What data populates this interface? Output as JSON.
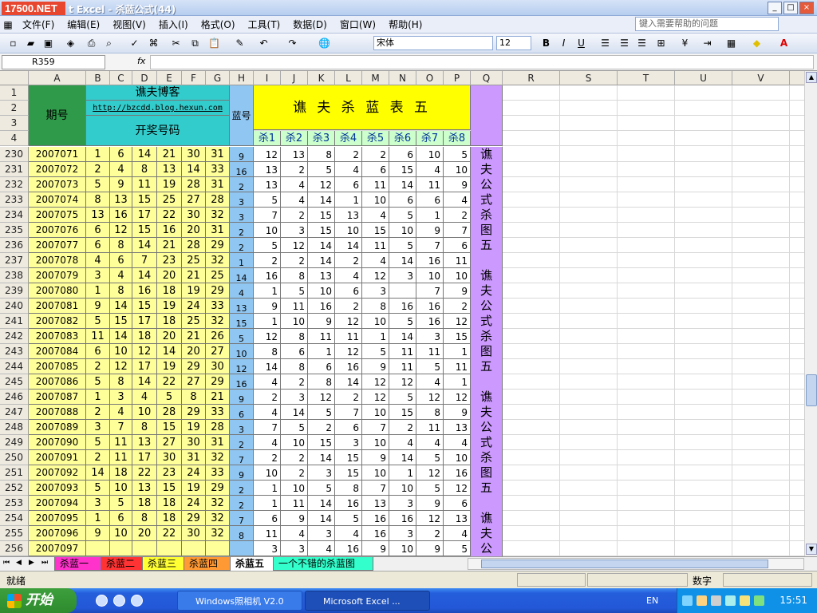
{
  "titlebar": {
    "logo": "17500.NET",
    "title": "t Excel - 杀蓝公式(44)",
    "min": "_",
    "max": "□",
    "close": "×"
  },
  "menu": [
    "文件(F)",
    "编辑(E)",
    "视图(V)",
    "插入(I)",
    "格式(O)",
    "工具(T)",
    "数据(D)",
    "窗口(W)",
    "帮助(H)"
  ],
  "help_placeholder": "键入需要帮助的问题",
  "font": {
    "name": "宋体",
    "size": "12"
  },
  "formula": {
    "cell": "R359",
    "fx": "fx",
    "value": ""
  },
  "columns": [
    "A",
    "B",
    "C",
    "D",
    "E",
    "F",
    "G",
    "H",
    "I",
    "J",
    "K",
    "L",
    "M",
    "N",
    "O",
    "P",
    "Q",
    "R",
    "S",
    "T",
    "U",
    "V"
  ],
  "header": {
    "rows": [
      "1",
      "2",
      "3",
      "4"
    ],
    "period": "期号",
    "blog": "谯夫博客",
    "url": "http://bzcdd.blog.hexun.com",
    "draw": "开奖号码",
    "blue": "蓝号",
    "table_title": "谯 夫 杀 蓝 表 五",
    "kill_cols": [
      "杀1",
      "杀2",
      "杀3",
      "杀4",
      "杀5",
      "杀6",
      "杀7",
      "杀8"
    ]
  },
  "rows": [
    {
      "r": "230",
      "p": "2007071",
      "n": [
        "1",
        "6",
        "14",
        "21",
        "30",
        "31"
      ],
      "b": "9",
      "k": [
        "12",
        "13",
        "8",
        "2",
        "2",
        "6",
        "10",
        "5"
      ],
      "q": "谯"
    },
    {
      "r": "231",
      "p": "2007072",
      "n": [
        "2",
        "4",
        "8",
        "13",
        "14",
        "33"
      ],
      "b": "16",
      "k": [
        "13",
        "2",
        "5",
        "4",
        "6",
        "15",
        "4",
        "10"
      ],
      "q": "夫"
    },
    {
      "r": "232",
      "p": "2007073",
      "n": [
        "5",
        "9",
        "11",
        "19",
        "28",
        "31"
      ],
      "b": "2",
      "k": [
        "13",
        "4",
        "12",
        "6",
        "11",
        "14",
        "11",
        "9"
      ],
      "q": "公"
    },
    {
      "r": "233",
      "p": "2007074",
      "n": [
        "8",
        "13",
        "15",
        "25",
        "27",
        "28"
      ],
      "b": "3",
      "k": [
        "5",
        "4",
        "14",
        "1",
        "10",
        "6",
        "6",
        "4"
      ],
      "q": "式"
    },
    {
      "r": "234",
      "p": "2007075",
      "n": [
        "13",
        "16",
        "17",
        "22",
        "30",
        "32"
      ],
      "b": "3",
      "k": [
        "7",
        "2",
        "15",
        "13",
        "4",
        "5",
        "1",
        "2"
      ],
      "q": "杀"
    },
    {
      "r": "235",
      "p": "2007076",
      "n": [
        "6",
        "12",
        "15",
        "16",
        "20",
        "31"
      ],
      "b": "2",
      "k": [
        "10",
        "3",
        "15",
        "10",
        "15",
        "10",
        "9",
        "7"
      ],
      "q": "图"
    },
    {
      "r": "236",
      "p": "2007077",
      "n": [
        "6",
        "8",
        "14",
        "21",
        "28",
        "29"
      ],
      "b": "2",
      "k": [
        "5",
        "12",
        "14",
        "14",
        "11",
        "5",
        "7",
        "6"
      ],
      "q": "五"
    },
    {
      "r": "237",
      "p": "2007078",
      "n": [
        "4",
        "6",
        "7",
        "23",
        "25",
        "32"
      ],
      "b": "1",
      "k": [
        "2",
        "2",
        "14",
        "2",
        "4",
        "14",
        "16",
        "11"
      ],
      "q": ""
    },
    {
      "r": "238",
      "p": "2007079",
      "n": [
        "3",
        "4",
        "14",
        "20",
        "21",
        "25"
      ],
      "b": "14",
      "k": [
        "16",
        "8",
        "13",
        "4",
        "12",
        "3",
        "10",
        "10"
      ],
      "q": "谯"
    },
    {
      "r": "239",
      "p": "2007080",
      "n": [
        "1",
        "8",
        "16",
        "18",
        "19",
        "29"
      ],
      "b": "4",
      "k": [
        "1",
        "5",
        "10",
        "6",
        "3",
        "",
        "7",
        "9"
      ],
      "q": "夫"
    },
    {
      "r": "240",
      "p": "2007081",
      "n": [
        "9",
        "14",
        "15",
        "19",
        "24",
        "33"
      ],
      "b": "13",
      "k": [
        "9",
        "11",
        "16",
        "2",
        "8",
        "16",
        "16",
        "2"
      ],
      "q": "公"
    },
    {
      "r": "241",
      "p": "2007082",
      "n": [
        "5",
        "15",
        "17",
        "18",
        "25",
        "32"
      ],
      "b": "15",
      "k": [
        "1",
        "10",
        "9",
        "12",
        "10",
        "5",
        "16",
        "12"
      ],
      "q": "式"
    },
    {
      "r": "242",
      "p": "2007083",
      "n": [
        "11",
        "14",
        "18",
        "20",
        "21",
        "26"
      ],
      "b": "5",
      "k": [
        "12",
        "8",
        "11",
        "11",
        "1",
        "14",
        "3",
        "15"
      ],
      "q": "杀"
    },
    {
      "r": "243",
      "p": "2007084",
      "n": [
        "6",
        "10",
        "12",
        "14",
        "20",
        "27"
      ],
      "b": "10",
      "k": [
        "8",
        "6",
        "1",
        "12",
        "5",
        "11",
        "11",
        "1"
      ],
      "q": "图"
    },
    {
      "r": "244",
      "p": "2007085",
      "n": [
        "2",
        "12",
        "17",
        "19",
        "29",
        "30"
      ],
      "b": "12",
      "k": [
        "14",
        "8",
        "6",
        "16",
        "9",
        "11",
        "5",
        "11"
      ],
      "q": "五"
    },
    {
      "r": "245",
      "p": "2007086",
      "n": [
        "5",
        "8",
        "14",
        "22",
        "27",
        "29"
      ],
      "b": "16",
      "k": [
        "4",
        "2",
        "8",
        "14",
        "12",
        "12",
        "4",
        "1"
      ],
      "q": ""
    },
    {
      "r": "246",
      "p": "2007087",
      "n": [
        "1",
        "3",
        "4",
        "5",
        "8",
        "21"
      ],
      "b": "9",
      "k": [
        "2",
        "3",
        "12",
        "2",
        "12",
        "5",
        "12",
        "12"
      ],
      "q": "谯"
    },
    {
      "r": "247",
      "p": "2007088",
      "n": [
        "2",
        "4",
        "10",
        "28",
        "29",
        "33"
      ],
      "b": "6",
      "k": [
        "4",
        "14",
        "5",
        "7",
        "10",
        "15",
        "8",
        "9"
      ],
      "q": "夫"
    },
    {
      "r": "248",
      "p": "2007089",
      "n": [
        "3",
        "7",
        "8",
        "15",
        "19",
        "28"
      ],
      "b": "3",
      "k": [
        "7",
        "5",
        "2",
        "6",
        "7",
        "2",
        "11",
        "13"
      ],
      "q": "公"
    },
    {
      "r": "249",
      "p": "2007090",
      "n": [
        "5",
        "11",
        "13",
        "27",
        "30",
        "31"
      ],
      "b": "2",
      "k": [
        "4",
        "10",
        "15",
        "3",
        "10",
        "4",
        "4",
        "4"
      ],
      "q": "式"
    },
    {
      "r": "250",
      "p": "2007091",
      "n": [
        "2",
        "11",
        "17",
        "30",
        "31",
        "32"
      ],
      "b": "7",
      "k": [
        "2",
        "2",
        "14",
        "15",
        "9",
        "14",
        "5",
        "10"
      ],
      "q": "杀"
    },
    {
      "r": "251",
      "p": "2007092",
      "n": [
        "14",
        "18",
        "22",
        "23",
        "24",
        "33"
      ],
      "b": "9",
      "k": [
        "10",
        "2",
        "3",
        "15",
        "10",
        "1",
        "12",
        "16"
      ],
      "q": "图"
    },
    {
      "r": "252",
      "p": "2007093",
      "n": [
        "5",
        "10",
        "13",
        "15",
        "19",
        "29"
      ],
      "b": "2",
      "k": [
        "1",
        "10",
        "5",
        "8",
        "7",
        "10",
        "5",
        "12"
      ],
      "q": "五"
    },
    {
      "r": "253",
      "p": "2007094",
      "n": [
        "3",
        "5",
        "18",
        "18",
        "24",
        "32"
      ],
      "b": "2",
      "k": [
        "1",
        "11",
        "14",
        "16",
        "13",
        "3",
        "9",
        "6"
      ],
      "q": ""
    },
    {
      "r": "254",
      "p": "2007095",
      "n": [
        "1",
        "6",
        "8",
        "18",
        "29",
        "32"
      ],
      "b": "7",
      "k": [
        "6",
        "9",
        "14",
        "5",
        "16",
        "16",
        "12",
        "13"
      ],
      "q": "谯"
    },
    {
      "r": "255",
      "p": "2007096",
      "n": [
        "9",
        "10",
        "20",
        "22",
        "30",
        "32"
      ],
      "b": "8",
      "k": [
        "11",
        "4",
        "3",
        "4",
        "16",
        "3",
        "2",
        "4"
      ],
      "q": "夫"
    },
    {
      "r": "256",
      "p": "2007097",
      "n": [
        "",
        "",
        "",
        "",
        "",
        ""
      ],
      "b": "",
      "k": [
        "3",
        "3",
        "4",
        "16",
        "9",
        "10",
        "9",
        "5"
      ],
      "q": "公"
    }
  ],
  "tabs": [
    {
      "label": "杀蓝一",
      "color": "#ff33cc"
    },
    {
      "label": "杀蓝二",
      "color": "#ff3333"
    },
    {
      "label": "杀蓝三",
      "color": "#ffff33"
    },
    {
      "label": "杀蓝四",
      "color": "#ff9933"
    },
    {
      "label": "杀蓝五",
      "color": "#ffffff"
    },
    {
      "label": "一个不错的杀蓝图",
      "color": "#33ffcc"
    }
  ],
  "status": {
    "left": "就绪",
    "mode": "数字"
  },
  "taskbar": {
    "start": "开始",
    "tasks": [
      "Windows照相机 V2.0",
      "Microsoft Excel ..."
    ],
    "lang": "EN",
    "clock": "15:51"
  }
}
